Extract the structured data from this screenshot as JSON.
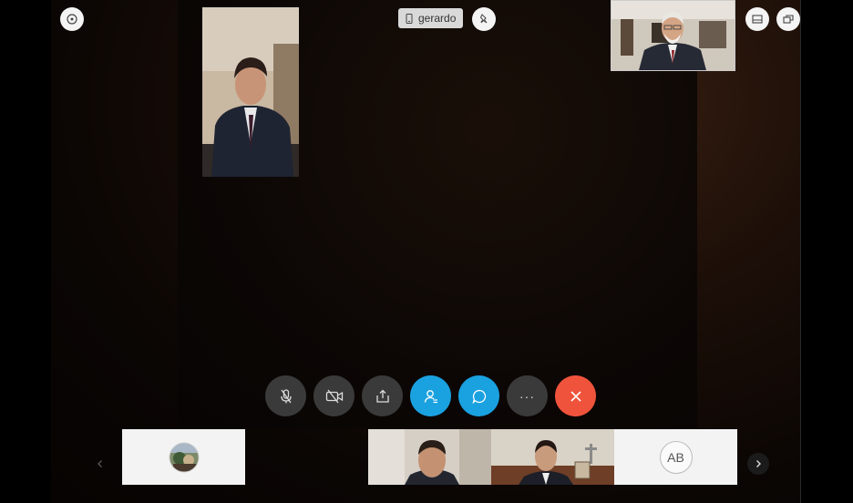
{
  "caller": {
    "name": "gerardo",
    "device_icon": "phone-icon"
  },
  "controls": [
    {
      "name": "mute-button",
      "icon": "mic-off-icon"
    },
    {
      "name": "video-button",
      "icon": "video-off-icon"
    },
    {
      "name": "share-button",
      "icon": "share-icon"
    },
    {
      "name": "participants-button",
      "icon": "participants-icon"
    },
    {
      "name": "chat-button",
      "icon": "chat-icon"
    },
    {
      "name": "more-button",
      "icon": "more-icon",
      "glyph": "···"
    },
    {
      "name": "end-call-button",
      "icon": "close-icon"
    }
  ],
  "participants_strip": [
    {
      "type": "avatar-photo"
    },
    {
      "type": "video"
    },
    {
      "type": "video"
    },
    {
      "type": "initials",
      "initials": "AB"
    }
  ],
  "colors": {
    "accent": "#1aa1e0",
    "end_call": "#f0533c",
    "control_bg": "#3a3a3a"
  }
}
